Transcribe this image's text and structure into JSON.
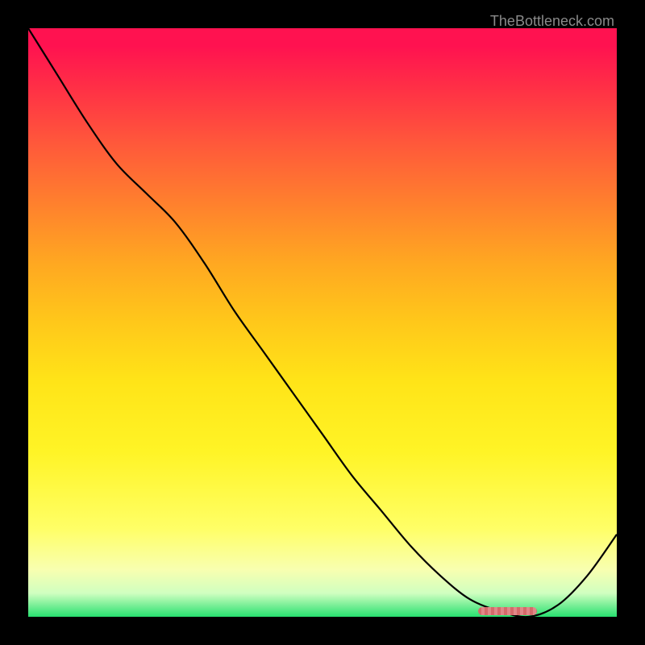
{
  "attribution": "TheBottleneck.com",
  "chart_data": {
    "type": "line",
    "title": "",
    "xlabel": "",
    "ylabel": "",
    "x": [
      0.0,
      0.05,
      0.1,
      0.15,
      0.2,
      0.25,
      0.3,
      0.35,
      0.4,
      0.45,
      0.5,
      0.55,
      0.6,
      0.65,
      0.7,
      0.75,
      0.8,
      0.85,
      0.9,
      0.95,
      1.0
    ],
    "values": [
      1.0,
      0.92,
      0.84,
      0.77,
      0.72,
      0.67,
      0.6,
      0.52,
      0.45,
      0.38,
      0.31,
      0.24,
      0.18,
      0.12,
      0.07,
      0.03,
      0.01,
      0.0,
      0.02,
      0.07,
      0.14
    ],
    "xlim": [
      0,
      1
    ],
    "ylim": [
      0,
      1
    ],
    "marker": {
      "x": 0.815,
      "width": 0.1
    },
    "gradient_stops": [
      "#ff1250",
      "#ff5a3a",
      "#ffa821",
      "#ffe418",
      "#ffff66",
      "#28e070"
    ]
  }
}
